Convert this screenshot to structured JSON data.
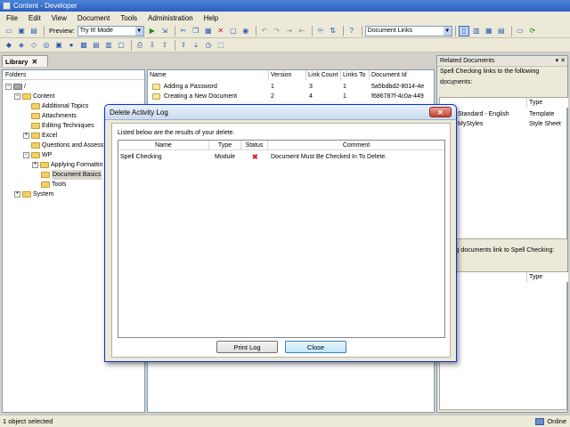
{
  "window": {
    "title": "Content - Developer"
  },
  "menu": [
    "File",
    "Edit",
    "View",
    "Document",
    "Tools",
    "Administration",
    "Help"
  ],
  "toolbar": {
    "preview_label": "Preview:",
    "preview_value": "Try It! Mode",
    "doc_links_value": "Document Links"
  },
  "tab": {
    "label": "Library",
    "close": "✕"
  },
  "folders": {
    "header": "Folders",
    "root": "/",
    "items": [
      {
        "label": "Content"
      },
      {
        "label": "Additional Topics"
      },
      {
        "label": "Attachments"
      },
      {
        "label": "Editing Techniques"
      },
      {
        "label": "Excel"
      },
      {
        "label": "Questions and Assess"
      },
      {
        "label": "WP"
      },
      {
        "label": "Applying Formattin"
      },
      {
        "label": "Document Basics"
      },
      {
        "label": "Tools"
      },
      {
        "label": "System"
      }
    ]
  },
  "doclist": {
    "columns": [
      "Name",
      "Version",
      "Link Count",
      "Links To",
      "Document Id"
    ],
    "rows": [
      {
        "name": "Adding a Password",
        "version": "1",
        "link_count": "3",
        "links_to": "1",
        "doc_id": "5a5bdbd2-8014-4e"
      },
      {
        "name": "Creating a New Document",
        "version": "2",
        "link_count": "4",
        "links_to": "1",
        "doc_id": "f686787f-4c0a-449"
      }
    ]
  },
  "related": {
    "title": "Related Documents",
    "subtitle": "Spell Checking links to the following documents:",
    "type_header": "Type",
    "rows": [
      {
        "name": "Standard - English",
        "type": "Template"
      },
      {
        "name": "MyStyles",
        "type": "Style Sheet"
      }
    ],
    "lower_subtitle": "llowing documents link to Spell Checking:",
    "lower_type_header": "Type"
  },
  "status": {
    "left": "1 object selected",
    "right": "Online"
  },
  "dialog": {
    "title": "Delete Activity Log",
    "message": "Listed below are the results of your delete.",
    "columns": [
      "Name",
      "Type",
      "Status",
      "Comment"
    ],
    "rows": [
      {
        "name": "Spell Checking",
        "type": "Module",
        "status": "✖",
        "comment": "Document Must Be Checked In To Delete."
      }
    ],
    "print_label": "Print Log",
    "close_label": "Close",
    "close_glyph": "✕"
  }
}
